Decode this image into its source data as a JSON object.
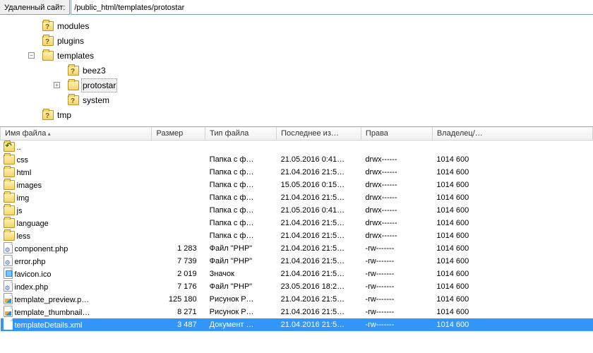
{
  "address": {
    "label": "Удаленный сайт:",
    "path": "/public_html/templates/protostar"
  },
  "tree": [
    {
      "name": "modules",
      "icon": "folder-q",
      "expander": ""
    },
    {
      "name": "plugins",
      "icon": "folder-q",
      "expander": ""
    },
    {
      "name": "templates",
      "icon": "folder",
      "expander": "minus",
      "children": [
        {
          "name": "beez3",
          "icon": "folder-q",
          "expander": ""
        },
        {
          "name": "protostar",
          "icon": "folder",
          "expander": "plus",
          "selected": true
        },
        {
          "name": "system",
          "icon": "folder-q",
          "expander": ""
        }
      ]
    },
    {
      "name": "tmp",
      "icon": "folder-q",
      "expander": ""
    }
  ],
  "columns": {
    "name": "Имя файла",
    "size": "Размер",
    "type": "Тип файла",
    "date": "Последнее из…",
    "perm": "Права",
    "owner": "Владелец/…"
  },
  "rows": [
    {
      "name": "..",
      "icon": "folder-up",
      "size": "",
      "type": "",
      "date": "",
      "perm": "",
      "owner": ""
    },
    {
      "name": "css",
      "icon": "folder",
      "size": "",
      "type": "Папка с ф…",
      "date": "21.05.2016 0:41…",
      "perm": "drwx------",
      "owner": "1014 600"
    },
    {
      "name": "html",
      "icon": "folder",
      "size": "",
      "type": "Папка с ф…",
      "date": "21.04.2016 21:5…",
      "perm": "drwx------",
      "owner": "1014 600"
    },
    {
      "name": "images",
      "icon": "folder",
      "size": "",
      "type": "Папка с ф…",
      "date": "15.05.2016 0:15…",
      "perm": "drwx------",
      "owner": "1014 600"
    },
    {
      "name": "img",
      "icon": "folder",
      "size": "",
      "type": "Папка с ф…",
      "date": "21.04.2016 21:5…",
      "perm": "drwx------",
      "owner": "1014 600"
    },
    {
      "name": "js",
      "icon": "folder",
      "size": "",
      "type": "Папка с ф…",
      "date": "21.05.2016 0:41…",
      "perm": "drwx------",
      "owner": "1014 600"
    },
    {
      "name": "language",
      "icon": "folder",
      "size": "",
      "type": "Папка с ф…",
      "date": "21.04.2016 21:5…",
      "perm": "drwx------",
      "owner": "1014 600"
    },
    {
      "name": "less",
      "icon": "folder",
      "size": "",
      "type": "Папка с ф…",
      "date": "21.04.2016 21:5…",
      "perm": "drwx------",
      "owner": "1014 600"
    },
    {
      "name": "component.php",
      "icon": "file-php",
      "size": "1 283",
      "type": "Файл \"PHP\"",
      "date": "21.04.2016 21:5…",
      "perm": "-rw-------",
      "owner": "1014 600"
    },
    {
      "name": "error.php",
      "icon": "file-php",
      "size": "7 739",
      "type": "Файл \"PHP\"",
      "date": "21.04.2016 21:5…",
      "perm": "-rw-------",
      "owner": "1014 600"
    },
    {
      "name": "favicon.ico",
      "icon": "file-icon",
      "size": "2 019",
      "type": "Значок",
      "date": "21.04.2016 21:5…",
      "perm": "-rw-------",
      "owner": "1014 600"
    },
    {
      "name": "index.php",
      "icon": "file-php",
      "size": "7 176",
      "type": "Файл \"PHP\"",
      "date": "23.05.2016 18:2…",
      "perm": "-rw-------",
      "owner": "1014 600"
    },
    {
      "name": "template_preview.p…",
      "icon": "file-img",
      "size": "125 180",
      "type": "Рисунок P…",
      "date": "21.04.2016 21:5…",
      "perm": "-rw-------",
      "owner": "1014 600"
    },
    {
      "name": "template_thumbnail…",
      "icon": "file-img",
      "size": "8 271",
      "type": "Рисунок P…",
      "date": "21.04.2016 21:5…",
      "perm": "-rw-------",
      "owner": "1014 600"
    },
    {
      "name": "templateDetails.xml",
      "icon": "file",
      "size": "3 487",
      "type": "Документ …",
      "date": "21.04.2016 21:5…",
      "perm": "-rw-------",
      "owner": "1014 600",
      "selected": true
    }
  ]
}
